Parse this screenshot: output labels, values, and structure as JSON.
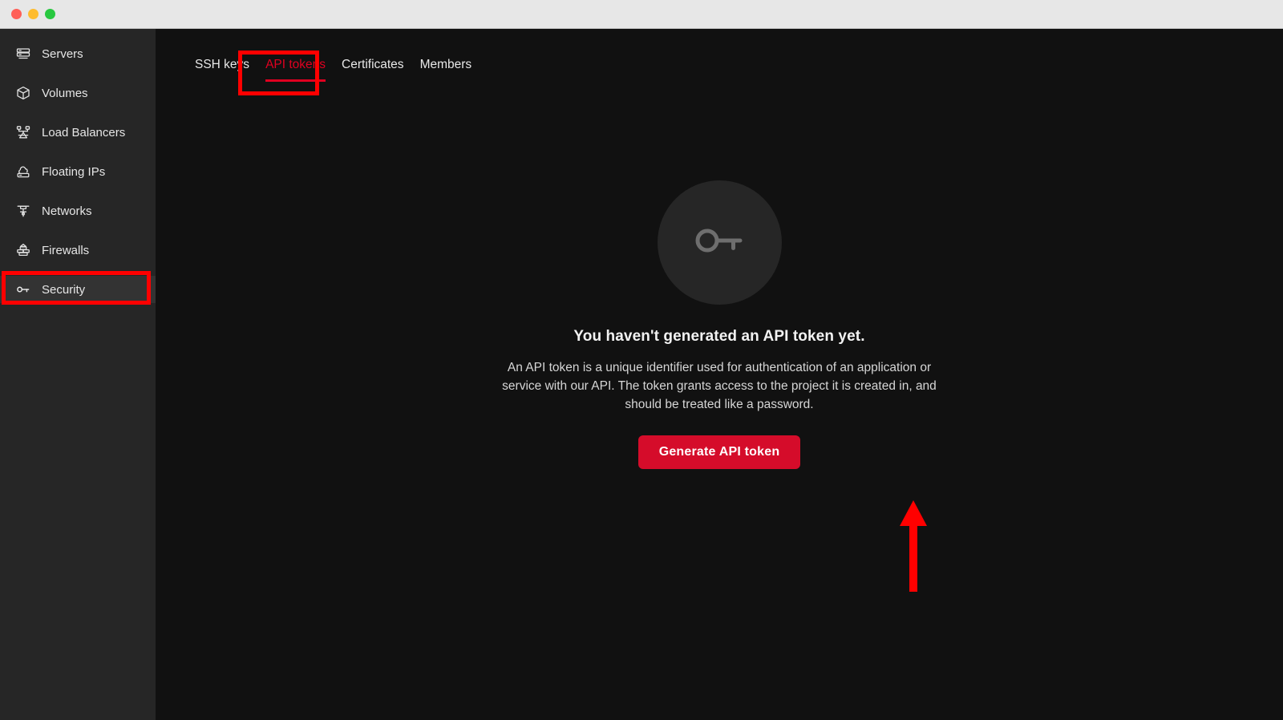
{
  "window": {
    "traffic_lights": [
      "close",
      "minimize",
      "maximize"
    ],
    "colors": {
      "close": "#ff5f57",
      "minimize": "#febc2e",
      "maximize": "#28c840"
    }
  },
  "sidebar": {
    "items": [
      {
        "label": "Servers",
        "icon": "servers-icon",
        "selected": false
      },
      {
        "label": "Volumes",
        "icon": "volume-cube-icon",
        "selected": false
      },
      {
        "label": "Load Balancers",
        "icon": "load-balancer-icon",
        "selected": false
      },
      {
        "label": "Floating IPs",
        "icon": "floating-ip-icon",
        "selected": false
      },
      {
        "label": "Networks",
        "icon": "network-icon",
        "selected": false
      },
      {
        "label": "Firewalls",
        "icon": "firewall-icon",
        "selected": false
      },
      {
        "label": "Security",
        "icon": "key-icon",
        "selected": true
      }
    ]
  },
  "tabs": [
    {
      "label": "SSH keys",
      "active": false
    },
    {
      "label": "API tokens",
      "active": true
    },
    {
      "label": "Certificates",
      "active": false
    },
    {
      "label": "Members",
      "active": false
    }
  ],
  "main": {
    "empty_state": {
      "icon": "key-icon",
      "title": "You haven't generated an API token yet.",
      "description": "An API token is a unique identifier used for authentication of an application or service with our API. The token grants access to the project it is created in, and should be treated like a password.",
      "button_label": "Generate API token"
    }
  },
  "annotations": {
    "color": "#ff0000",
    "boxes": [
      {
        "target": "tab-api-tokens"
      },
      {
        "target": "sidebar-item-security"
      }
    ],
    "arrow": {
      "target": "generate-api-token-button",
      "direction": "up"
    }
  },
  "colors": {
    "accent_red": "#e00020",
    "button_red": "#d50c2a",
    "annotation_red": "#ff0000",
    "sidebar_bg": "#262626",
    "main_bg": "#111111",
    "titlebar_bg": "#e7e7e7"
  }
}
